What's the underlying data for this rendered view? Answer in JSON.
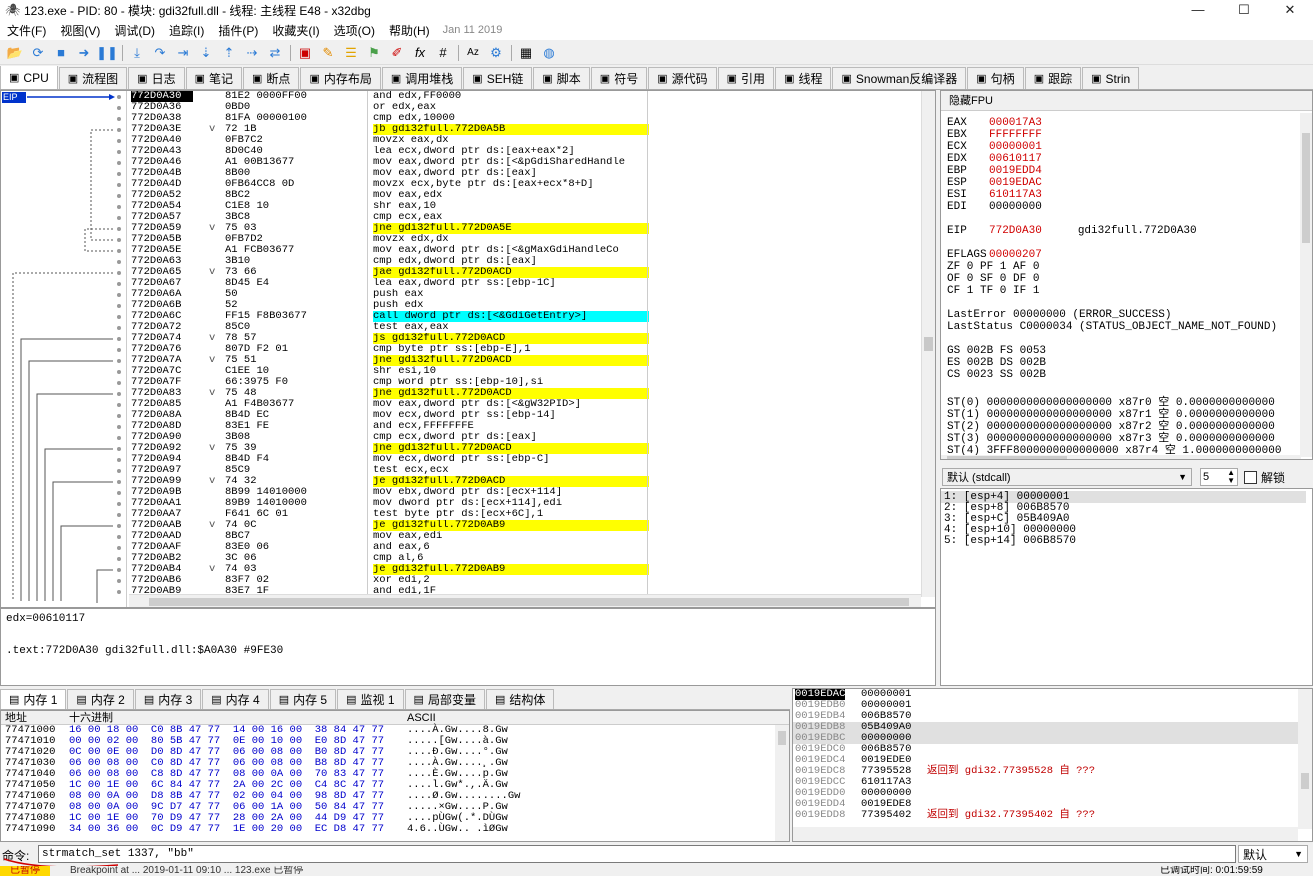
{
  "window": {
    "title": "123.exe - PID: 80 - 模块: gdi32full.dll - 线程: 主线程 E48 - x32dbg"
  },
  "menu": {
    "items": [
      "文件(F)",
      "视图(V)",
      "调试(D)",
      "追踪(I)",
      "插件(P)",
      "收藏夹(I)",
      "选项(O)",
      "帮助(H)"
    ],
    "date": "Jan 11 2019"
  },
  "tabs": [
    {
      "label": "CPU",
      "icon": "cpu-icon"
    },
    {
      "label": "流程图",
      "icon": "graph-icon"
    },
    {
      "label": "日志",
      "icon": "log-icon"
    },
    {
      "label": "笔记",
      "icon": "notes-icon"
    },
    {
      "label": "断点",
      "icon": "breakpoint-icon"
    },
    {
      "label": "内存布局",
      "icon": "memory-map-icon"
    },
    {
      "label": "调用堆栈",
      "icon": "callstack-icon"
    },
    {
      "label": "SEH链",
      "icon": "seh-icon"
    },
    {
      "label": "脚本",
      "icon": "script-icon"
    },
    {
      "label": "符号",
      "icon": "symbol-icon"
    },
    {
      "label": "源代码",
      "icon": "source-icon"
    },
    {
      "label": "引用",
      "icon": "reference-icon"
    },
    {
      "label": "线程",
      "icon": "thread-icon"
    },
    {
      "label": "Snowman反编译器",
      "icon": "snowman-icon"
    },
    {
      "label": "句柄",
      "icon": "handle-icon"
    },
    {
      "label": "跟踪",
      "icon": "trace-icon"
    },
    {
      "label": "Strin",
      "icon": "string-icon"
    }
  ],
  "disasm": {
    "eip_label": "EIP",
    "rows": [
      {
        "addr": "772D0A30",
        "mark": "",
        "bytes": "81E2 0000FF00",
        "ins": "and edx,FF0000"
      },
      {
        "addr": "772D0A36",
        "mark": "",
        "bytes": "0BD0",
        "ins": "or edx,eax"
      },
      {
        "addr": "772D0A38",
        "mark": "",
        "bytes": "81FA 00000100",
        "ins": "cmp edx,10000"
      },
      {
        "addr": "772D0A3E",
        "mark": "v",
        "bytes": "72 1B",
        "ins": "jb gdi32full.772D0A5B"
      },
      {
        "addr": "772D0A40",
        "mark": "",
        "bytes": "0FB7C2",
        "ins": "movzx eax,dx"
      },
      {
        "addr": "772D0A43",
        "mark": "",
        "bytes": "8D0C40",
        "ins": "lea ecx,dword ptr ds:[eax+eax*2]"
      },
      {
        "addr": "772D0A46",
        "mark": "",
        "bytes": "A1 00B13677",
        "ins": "mov eax,dword ptr ds:[<&pGdiSharedHandle"
      },
      {
        "addr": "772D0A4B",
        "mark": "",
        "bytes": "8B00",
        "ins": "mov eax,dword ptr ds:[eax]"
      },
      {
        "addr": "772D0A4D",
        "mark": "",
        "bytes": "0FB64CC8 0D",
        "ins": "movzx ecx,byte ptr ds:[eax+ecx*8+D]"
      },
      {
        "addr": "772D0A52",
        "mark": "",
        "bytes": "8BC2",
        "ins": "mov eax,edx"
      },
      {
        "addr": "772D0A54",
        "mark": "",
        "bytes": "C1E8 10",
        "ins": "shr eax,10"
      },
      {
        "addr": "772D0A57",
        "mark": "",
        "bytes": "3BC8",
        "ins": "cmp ecx,eax"
      },
      {
        "addr": "772D0A59",
        "mark": "v",
        "bytes": "75 03",
        "ins": "jne gdi32full.772D0A5E"
      },
      {
        "addr": "772D0A5B",
        "mark": "",
        "bytes": "0FB7D2",
        "ins": "movzx edx,dx"
      },
      {
        "addr": "772D0A5E",
        "mark": "",
        "bytes": "A1 FCB03677",
        "ins": "mov eax,dword ptr ds:[<&gMaxGdiHandleCo"
      },
      {
        "addr": "772D0A63",
        "mark": "",
        "bytes": "3B10",
        "ins": "cmp edx,dword ptr ds:[eax]"
      },
      {
        "addr": "772D0A65",
        "mark": "v",
        "bytes": "73 66",
        "ins": "jae gdi32full.772D0ACD"
      },
      {
        "addr": "772D0A67",
        "mark": "",
        "bytes": "8D45 E4",
        "ins": "lea eax,dword ptr ss:[ebp-1C]"
      },
      {
        "addr": "772D0A6A",
        "mark": "",
        "bytes": "50",
        "ins": "push eax"
      },
      {
        "addr": "772D0A6B",
        "mark": "",
        "bytes": "52",
        "ins": "push edx"
      },
      {
        "addr": "772D0A6C",
        "mark": "",
        "bytes": "FF15 F8B03677",
        "ins": "call dword ptr ds:[<&GdiGetEntry>]"
      },
      {
        "addr": "772D0A72",
        "mark": "",
        "bytes": "85C0",
        "ins": "test eax,eax"
      },
      {
        "addr": "772D0A74",
        "mark": "v",
        "bytes": "78 57",
        "ins": "js gdi32full.772D0ACD"
      },
      {
        "addr": "772D0A76",
        "mark": "",
        "bytes": "807D F2 01",
        "ins": "cmp byte ptr ss:[ebp-E],1"
      },
      {
        "addr": "772D0A7A",
        "mark": "v",
        "bytes": "75 51",
        "ins": "jne gdi32full.772D0ACD"
      },
      {
        "addr": "772D0A7C",
        "mark": "",
        "bytes": "C1EE 10",
        "ins": "shr esi,10"
      },
      {
        "addr": "772D0A7F",
        "mark": "",
        "bytes": "66:3975 F0",
        "ins": "cmp word ptr ss:[ebp-10],si"
      },
      {
        "addr": "772D0A83",
        "mark": "v",
        "bytes": "75 48",
        "ins": "jne gdi32full.772D0ACD"
      },
      {
        "addr": "772D0A85",
        "mark": "",
        "bytes": "A1 F4B03677",
        "ins": "mov eax,dword ptr ds:[<&gW32PID>]"
      },
      {
        "addr": "772D0A8A",
        "mark": "",
        "bytes": "8B4D EC",
        "ins": "mov ecx,dword ptr ss:[ebp-14]"
      },
      {
        "addr": "772D0A8D",
        "mark": "",
        "bytes": "83E1 FE",
        "ins": "and ecx,FFFFFFFE"
      },
      {
        "addr": "772D0A90",
        "mark": "",
        "bytes": "3B08",
        "ins": "cmp ecx,dword ptr ds:[eax]"
      },
      {
        "addr": "772D0A92",
        "mark": "v",
        "bytes": "75 39",
        "ins": "jne gdi32full.772D0ACD"
      },
      {
        "addr": "772D0A94",
        "mark": "",
        "bytes": "8B4D F4",
        "ins": "mov ecx,dword ptr ss:[ebp-C]"
      },
      {
        "addr": "772D0A97",
        "mark": "",
        "bytes": "85C9",
        "ins": "test ecx,ecx"
      },
      {
        "addr": "772D0A99",
        "mark": "v",
        "bytes": "74 32",
        "ins": "je gdi32full.772D0ACD"
      },
      {
        "addr": "772D0A9B",
        "mark": "",
        "bytes": "8B99 14010000",
        "ins": "mov ebx,dword ptr ds:[ecx+114]"
      },
      {
        "addr": "772D0AA1",
        "mark": "",
        "bytes": "89B9 14010000",
        "ins": "mov dword ptr ds:[ecx+114],edi"
      },
      {
        "addr": "772D0AA7",
        "mark": "",
        "bytes": "F641 6C 01",
        "ins": "test byte ptr ds:[ecx+6C],1"
      },
      {
        "addr": "772D0AAB",
        "mark": "v",
        "bytes": "74 0C",
        "ins": "je gdi32full.772D0AB9"
      },
      {
        "addr": "772D0AAD",
        "mark": "",
        "bytes": "8BC7",
        "ins": "mov eax,edi"
      },
      {
        "addr": "772D0AAF",
        "mark": "",
        "bytes": "83E0 06",
        "ins": "and eax,6"
      },
      {
        "addr": "772D0AB2",
        "mark": "",
        "bytes": "3C 06",
        "ins": "cmp al,6"
      },
      {
        "addr": "772D0AB4",
        "mark": "v",
        "bytes": "74 03",
        "ins": "je gdi32full.772D0AB9"
      },
      {
        "addr": "772D0AB6",
        "mark": "",
        "bytes": "83F7 02",
        "ins": "xor edi,2"
      },
      {
        "addr": "772D0AB9",
        "mark": "",
        "bytes": "83E7 1F",
        "ins": "and edi,1F"
      }
    ]
  },
  "info": {
    "line1": "edx=00610117",
    "line2": ".text:772D0A30 gdi32full.dll:$A0A30 #9FE30"
  },
  "registers": {
    "header": "隐藏FPU",
    "gp": [
      {
        "name": "EAX",
        "value": "000017A3"
      },
      {
        "name": "EBX",
        "value": "FFFFFFFF"
      },
      {
        "name": "ECX",
        "value": "00000001"
      },
      {
        "name": "EDX",
        "value": "00610117"
      },
      {
        "name": "EBP",
        "value": "0019EDD4"
      },
      {
        "name": "ESP",
        "value": "0019EDAC"
      },
      {
        "name": "ESI",
        "value": "610117A3"
      },
      {
        "name": "EDI",
        "value": "00000000"
      }
    ],
    "eip": {
      "name": "EIP",
      "value": "772D0A30",
      "symbol": "gdi32full.772D0A30"
    },
    "eflags": {
      "name": "EFLAGS",
      "value": "00000207"
    },
    "flags_lines": [
      "ZF 0  PF 1  AF 0",
      "OF 0  SF 0  DF 0",
      "CF 1  TF 0  IF 1"
    ],
    "last_error": "LastError  00000000 (ERROR_SUCCESS)",
    "last_status": "LastStatus C0000034 (STATUS_OBJECT_NAME_NOT_FOUND)",
    "segs": [
      "GS 002B  FS 0053",
      "ES 002B  DS 002B",
      "CS 0023  SS 002B"
    ],
    "fpu": [
      "ST(0) 0000000000000000000 x87r0 空 0.0000000000000",
      "ST(1) 0000000000000000000 x87r1 空 0.0000000000000",
      "ST(2) 0000000000000000000 x87r2 空 0.0000000000000",
      "ST(3) 0000000000000000000 x87r3 空 0.0000000000000",
      "ST(4) 3FFF8000000000000000 x87r4 空 1.0000000000000"
    ]
  },
  "callconv": {
    "value": "默认 (stdcall)",
    "count": "5",
    "unlock_label": "解锁"
  },
  "stack_args": [
    "1: [esp+4]  00000001",
    "2: [esp+8]  006B8570",
    "3: [esp+C]  05B409A0",
    "4: [esp+10] 00000000",
    "5: [esp+14] 006B8570"
  ],
  "mem_tabs": [
    {
      "label": "内存 1",
      "icon": "memory-icon"
    },
    {
      "label": "内存 2",
      "icon": "memory-icon"
    },
    {
      "label": "内存 3",
      "icon": "memory-icon"
    },
    {
      "label": "内存 4",
      "icon": "memory-icon"
    },
    {
      "label": "内存 5",
      "icon": "memory-icon"
    },
    {
      "label": "监视 1",
      "icon": "watch-icon"
    },
    {
      "label": "局部变量",
      "icon": "locals-icon"
    },
    {
      "label": "结构体",
      "icon": "struct-icon"
    }
  ],
  "dump": {
    "headers": {
      "addr": "地址",
      "hex": "十六进制",
      "ascii": "ASCII"
    },
    "rows": [
      {
        "addr": "77471000",
        "hex": "16 00 18 00  C0 8B 47 77  14 00 16 00  38 84 47 77",
        "ascii": "....À.Gw....8.Gw"
      },
      {
        "addr": "77471010",
        "hex": "00 00 02 00  80 5B 47 77  0E 00 10 00  E0 8D 47 77",
        "ascii": ".....[Gw....à.Gw"
      },
      {
        "addr": "77471020",
        "hex": "0C 00 0E 00  D0 8D 47 77  06 00 08 00  B0 8D 47 77",
        "ascii": "....Ð.Gw....°.Gw"
      },
      {
        "addr": "77471030",
        "hex": "06 00 08 00  C0 8D 47 77  06 00 08 00  B8 8D 47 77",
        "ascii": "....À.Gw....¸.Gw"
      },
      {
        "addr": "77471040",
        "hex": "06 00 08 00  C8 8D 47 77  08 00 0A 00  70 83 47 77",
        "ascii": "....È.Gw....p.Gw"
      },
      {
        "addr": "77471050",
        "hex": "1C 00 1E 00  6C 84 47 77  2A 00 2C 00  C4 8C 47 77",
        "ascii": "....l.Gw*.,.Ä.Gw"
      },
      {
        "addr": "77471060",
        "hex": "08 00 0A 00  D8 8B 47 77  02 00 04 00  98 8D 47 77",
        "ascii": "....Ø.Gw........Gw"
      },
      {
        "addr": "77471070",
        "hex": "08 00 0A 00  9C D7 47 77  06 00 1A 00  50 84 47 77",
        "ascii": ".....×Gw....P.Gw"
      },
      {
        "addr": "77471080",
        "hex": "1C 00 1E 00  70 D9 47 77  28 00 2A 00  44 D9 47 77",
        "ascii": "....pÙGw(.*.DÙGw"
      },
      {
        "addr": "77471090",
        "hex": "34 00 36 00  0C D9 47 77  1E 00 20 00  EC D8 47 77",
        "ascii": "4.6..ÙGw.. .ìØGw"
      }
    ]
  },
  "stack": {
    "rows": [
      {
        "addr": "0019EDAC",
        "value": "00000001",
        "comment": "",
        "current": true
      },
      {
        "addr": "0019EDB0",
        "value": "00000001",
        "comment": ""
      },
      {
        "addr": "0019EDB4",
        "value": "006B8570",
        "comment": ""
      },
      {
        "addr": "0019EDB8",
        "value": "05B409A0",
        "comment": ""
      },
      {
        "addr": "0019EDBC",
        "value": "00000000",
        "comment": ""
      },
      {
        "addr": "0019EDC0",
        "value": "006B8570",
        "comment": ""
      },
      {
        "addr": "0019EDC4",
        "value": "0019EDE0",
        "comment": ""
      },
      {
        "addr": "0019EDC8",
        "value": "77395528",
        "comment": "返回到 gdi32.77395528 自 ???"
      },
      {
        "addr": "0019EDCC",
        "value": "610117A3",
        "comment": ""
      },
      {
        "addr": "0019EDD0",
        "value": "00000000",
        "comment": ""
      },
      {
        "addr": "0019EDD4",
        "value": "0019EDE8",
        "comment": ""
      },
      {
        "addr": "0019EDD8",
        "value": "77395402",
        "comment": "返回到 gdi32.77395402 自 ???"
      }
    ]
  },
  "command": {
    "label": "命令:",
    "value": "strmatch_set 1337, \"bb\"",
    "dropdown": "默认"
  },
  "status": {
    "state": "已暂停",
    "text": "Breakpoint at ... 2019-01-11 09:10 ... 123.exe 已暂停",
    "time": "已调试时间: 0:01:59:59"
  }
}
